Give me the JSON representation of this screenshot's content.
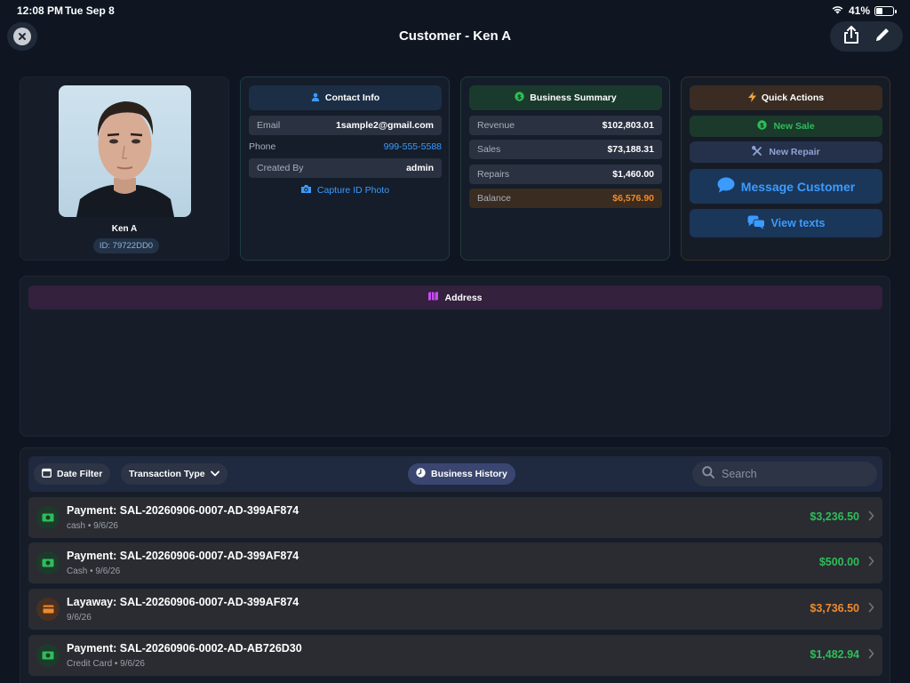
{
  "status_bar": {
    "time": "12:08 PM",
    "date": "Tue Sep 8",
    "battery": "41%",
    "battery_level": 0.41
  },
  "nav": {
    "title": "Customer - Ken A"
  },
  "profile": {
    "name": "Ken A",
    "id": "ID: 79722DD0"
  },
  "contact": {
    "header": "Contact Info",
    "email_label": "Email",
    "email": "1sample2@gmail.com",
    "phone_label": "Phone",
    "phone": "999-555-5588",
    "created_label": "Created By",
    "created_by": "admin",
    "capture_label": "Capture ID Photo"
  },
  "summary": {
    "header": "Business Summary",
    "rows": [
      {
        "label": "Revenue",
        "value": "$102,803.01"
      },
      {
        "label": "Sales",
        "value": "$73,188.31"
      },
      {
        "label": "Repairs",
        "value": "$1,460.00"
      },
      {
        "label": "Balance",
        "value": "$6,576.90"
      }
    ]
  },
  "quick_actions": {
    "header": "Quick Actions",
    "new_sale": "New Sale",
    "new_repair": "New Repair",
    "message_customer": "Message Customer",
    "view_texts": "View texts"
  },
  "address": {
    "header": "Address"
  },
  "history": {
    "date_filter": "Date Filter",
    "transaction_type": "Transaction Type",
    "business_history": "Business History",
    "search_placeholder": "Search",
    "transactions": [
      {
        "title": "Payment: SAL-20260906-0007-AD-399AF874",
        "sub": "cash • 9/6/26",
        "amount": "$3,236.50",
        "kind": "payment",
        "color": "#2ebd59"
      },
      {
        "title": "Payment: SAL-20260906-0007-AD-399AF874",
        "sub": "Cash • 9/6/26",
        "amount": "$500.00",
        "kind": "payment",
        "color": "#2ebd59"
      },
      {
        "title": "Layaway: SAL-20260906-0007-AD-399AF874",
        "sub": "9/6/26",
        "amount": "$3,736.50",
        "kind": "layaway",
        "color": "#f08a2c"
      },
      {
        "title": "Payment: SAL-20260906-0002-AD-AB726D30",
        "sub": "Credit Card • 9/6/26",
        "amount": "$1,482.94",
        "kind": "payment",
        "color": "#2ebd59"
      }
    ]
  },
  "colors": {
    "accent_blue": "#3c9bff",
    "green": "#2ebd59",
    "orange": "#f08a2c",
    "purple": "#c64cf2"
  }
}
